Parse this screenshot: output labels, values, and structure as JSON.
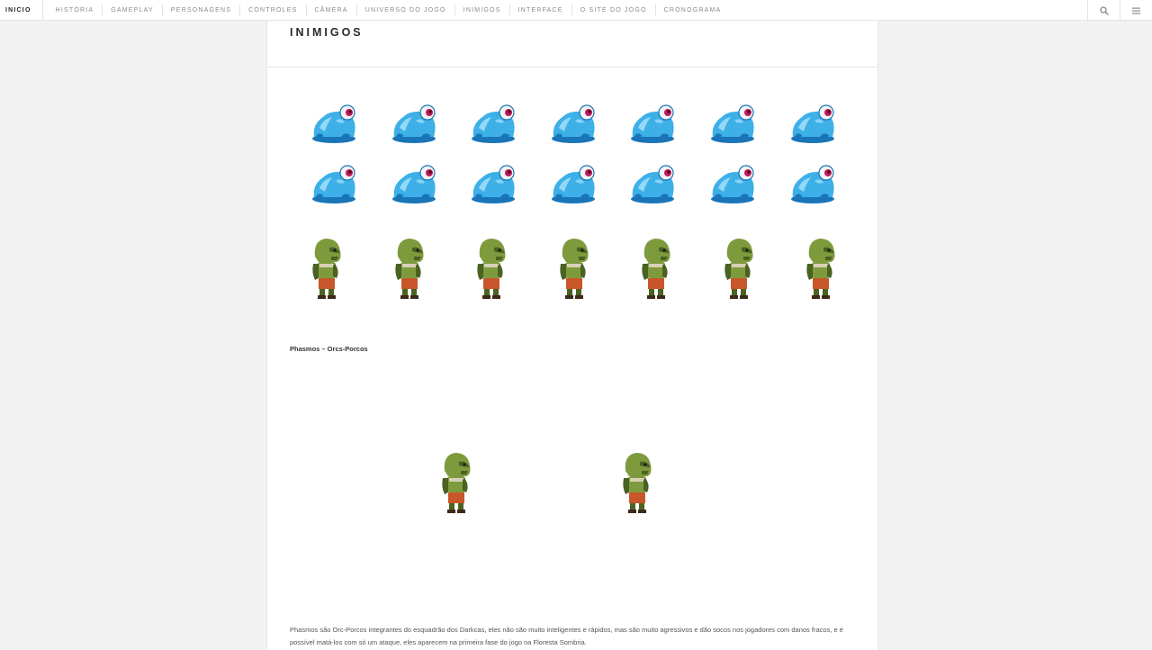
{
  "nav": {
    "home": "INICIO",
    "items": [
      "HISTÓRIA",
      "GAMEPLAY",
      "PERSONAGENS",
      "CONTROLES",
      "CÂMERA",
      "UNIVERSO DO JOGO",
      "INIMIGOS",
      "INTERFACE",
      "O SITE DO JOGO",
      "CRONOGRAMA"
    ]
  },
  "icons": {
    "search": "search-icon",
    "menu": "hamburger-menu-icon"
  },
  "page": {
    "title": "INIMIGOS",
    "caption": "Phasmos – Orcs-Porcos",
    "paragraph": "Phasmos são Orc-Porcos integrantes do esquadrão dos Darkcas, eles não são muito inteligentes e rápidos, mas são muito agressivos e dão socos nos jogadores com danos fracos, e é possível matá-los com só um ataque, eles aparecem na primeira fase do jogo na Floresta Sombria."
  },
  "gallery": {
    "frog_sprite_count": 14,
    "orc_sprite_count": 7,
    "featured_orc_count": 2
  },
  "colors": {
    "frog_body": "#3db0e8",
    "frog_dark": "#1a74b8",
    "frog_light": "#a8e4fa",
    "frog_eye": "#c2185b",
    "orc_skin": "#7d9b3c",
    "orc_dark": "#4a6222",
    "orc_pants": "#c8562a"
  }
}
